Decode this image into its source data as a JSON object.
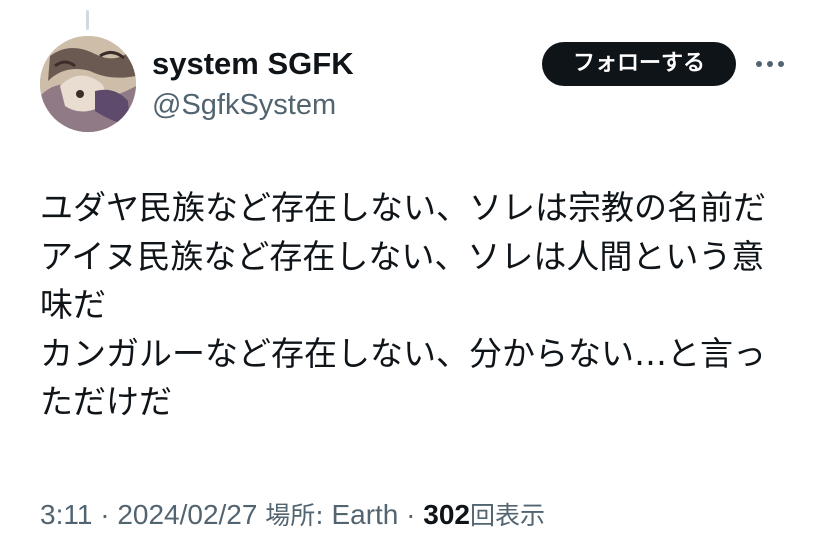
{
  "author": {
    "display_name": "system SGFK",
    "handle": "@SgfkSystem"
  },
  "follow_button": {
    "label": "フォローする"
  },
  "more_icon": "more-horizontal-icon",
  "tweet": {
    "lines": [
      "ユダヤ民族など存在しない、ソレは宗教の名前だ",
      "アイヌ民族など存在しない、ソレは人間という意",
      "味だ",
      "カンガルーなど存在しない、分からない…と言っ",
      "ただけだ"
    ]
  },
  "meta": {
    "time": "3:11",
    "separator": "·",
    "date": "2024/02/27",
    "location_prefix": "場所:",
    "location": "Earth",
    "views_count": "302",
    "views_label": "回表示"
  },
  "colors": {
    "text_primary": "#0f1419",
    "text_secondary": "#536471",
    "button_bg": "#0f1419",
    "button_text": "#ffffff",
    "thread_line": "#cfd9de"
  }
}
